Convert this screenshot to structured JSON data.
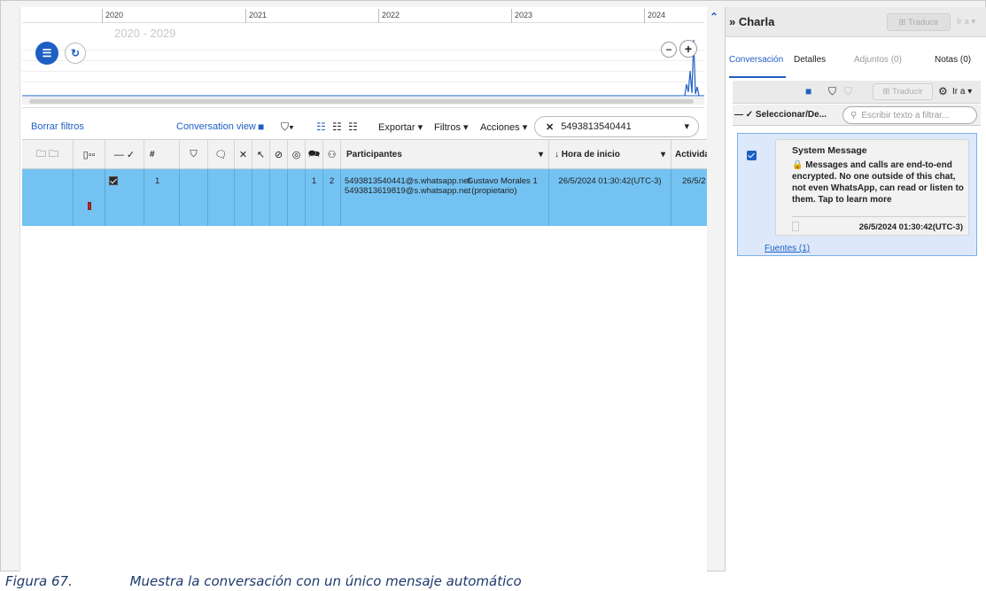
{
  "timeline": {
    "years": [
      "2020",
      "2021",
      "2022",
      "2023",
      "2024"
    ],
    "range_label": "2020 - 2029"
  },
  "toolbar": {
    "clear_filters": "Borrar filtros",
    "conversation_view": "Conversation view",
    "export": "Exportar ▾",
    "filters": "Filtros ▾",
    "actions": "Acciones ▾",
    "search_value": "5493813540441"
  },
  "grid": {
    "columns": {
      "num": "#",
      "participants": "Participantes",
      "start_time": "↓ Hora de inicio",
      "activity": "Activida"
    },
    "row": {
      "index": "1",
      "messages_count": "1",
      "participants_count": "2",
      "participant_ids": [
        "5493813540441@s.whatsapp.net",
        "5493813619819@s.whatsapp.net"
      ],
      "participant_names": [
        "Gustavo Morales 1",
        ". (propietario)"
      ],
      "start_time": "26/5/2024 01:30:42(UTC-3)",
      "activity": "26/5/2"
    }
  },
  "chat_panel": {
    "title": "» Charla",
    "translate": "Traducir",
    "go_to": "Ir a ▾",
    "tabs": [
      {
        "label": "Conversación"
      },
      {
        "label": "Detalles"
      },
      {
        "label": "Adjuntos (0)"
      },
      {
        "label": "Notas (0)"
      }
    ],
    "select_label": "— ✓ Seleccionar/De...",
    "filter_placeholder": "Escribir texto a filtrar...",
    "message": {
      "sender": "System Message",
      "body": "🔒 Messages and calls are end-to-end encrypted. No one outside of this chat, not even WhatsApp, can read or listen to them. Tap to learn more",
      "timestamp": "26/5/2024 01:30:42(UTC-3)"
    },
    "sources": "Fuentes (1)"
  },
  "caption": {
    "label": "Figura 67.",
    "text": "Muestra la conversación con un único mensaje automático"
  }
}
